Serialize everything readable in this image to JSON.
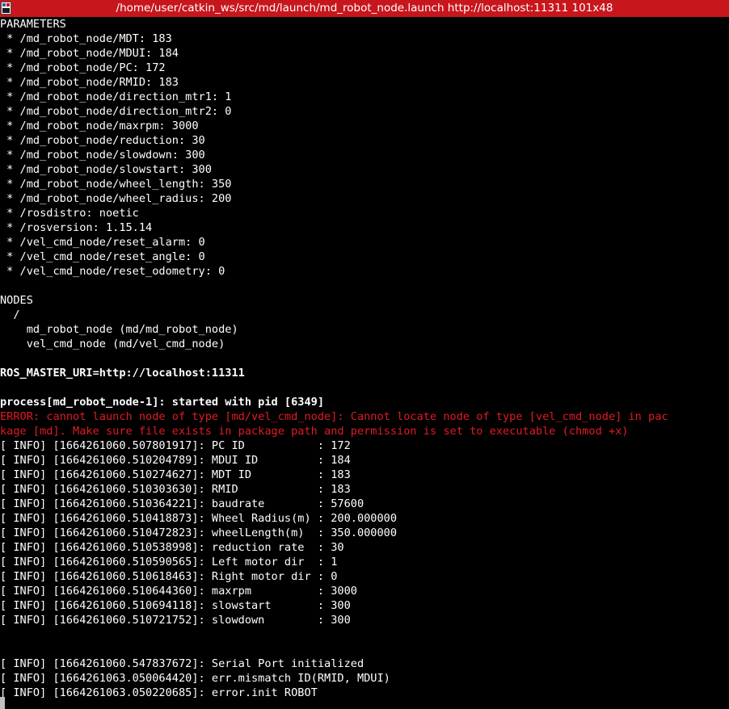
{
  "window": {
    "title": "/home/user/catkin_ws/src/md/launch/md_robot_node.launch http://localhost:11311 101x48",
    "title_bg": "#c8161d",
    "icon": "terminal-app-icon"
  },
  "colors": {
    "background": "#000000",
    "text": "#ffffff",
    "error": "#e01b24"
  },
  "terminal": {
    "lines": [
      {
        "text": "PARAMETERS",
        "style": "normal"
      },
      {
        "text": " * /md_robot_node/MDT: 183",
        "style": "normal"
      },
      {
        "text": " * /md_robot_node/MDUI: 184",
        "style": "normal"
      },
      {
        "text": " * /md_robot_node/PC: 172",
        "style": "normal"
      },
      {
        "text": " * /md_robot_node/RMID: 183",
        "style": "normal"
      },
      {
        "text": " * /md_robot_node/direction_mtr1: 1",
        "style": "normal"
      },
      {
        "text": " * /md_robot_node/direction_mtr2: 0",
        "style": "normal"
      },
      {
        "text": " * /md_robot_node/maxrpm: 3000",
        "style": "normal"
      },
      {
        "text": " * /md_robot_node/reduction: 30",
        "style": "normal"
      },
      {
        "text": " * /md_robot_node/slowdown: 300",
        "style": "normal"
      },
      {
        "text": " * /md_robot_node/slowstart: 300",
        "style": "normal"
      },
      {
        "text": " * /md_robot_node/wheel_length: 350",
        "style": "normal"
      },
      {
        "text": " * /md_robot_node/wheel_radius: 200",
        "style": "normal"
      },
      {
        "text": " * /rosdistro: noetic",
        "style": "normal"
      },
      {
        "text": " * /rosversion: 1.15.14",
        "style": "normal"
      },
      {
        "text": " * /vel_cmd_node/reset_alarm: 0",
        "style": "normal"
      },
      {
        "text": " * /vel_cmd_node/reset_angle: 0",
        "style": "normal"
      },
      {
        "text": " * /vel_cmd_node/reset_odometry: 0",
        "style": "normal"
      },
      {
        "text": "",
        "style": "normal"
      },
      {
        "text": "NODES",
        "style": "normal"
      },
      {
        "text": "  /",
        "style": "normal"
      },
      {
        "text": "    md_robot_node (md/md_robot_node)",
        "style": "normal"
      },
      {
        "text": "    vel_cmd_node (md/vel_cmd_node)",
        "style": "normal"
      },
      {
        "text": "",
        "style": "normal"
      },
      {
        "text": "ROS_MASTER_URI=http://localhost:11311",
        "style": "bold"
      },
      {
        "text": "",
        "style": "normal"
      },
      {
        "text": "process[md_robot_node-1]: started with pid [6349]",
        "style": "bold"
      },
      {
        "text": "ERROR: cannot launch node of type [md/vel_cmd_node]: Cannot locate node of type [vel_cmd_node] in pac",
        "style": "error"
      },
      {
        "text": "kage [md]. Make sure file exists in package path and permission is set to executable (chmod +x)",
        "style": "error"
      },
      {
        "text": "[ INFO] [1664261060.507801917]: PC ID           : 172",
        "style": "normal"
      },
      {
        "text": "[ INFO] [1664261060.510204789]: MDUI ID         : 184",
        "style": "normal"
      },
      {
        "text": "[ INFO] [1664261060.510274627]: MDT ID          : 183",
        "style": "normal"
      },
      {
        "text": "[ INFO] [1664261060.510303630]: RMID            : 183",
        "style": "normal"
      },
      {
        "text": "[ INFO] [1664261060.510364221]: baudrate        : 57600",
        "style": "normal"
      },
      {
        "text": "[ INFO] [1664261060.510418873]: Wheel Radius(m) : 200.000000",
        "style": "normal"
      },
      {
        "text": "[ INFO] [1664261060.510472823]: wheelLength(m)  : 350.000000",
        "style": "normal"
      },
      {
        "text": "[ INFO] [1664261060.510538998]: reduction rate  : 30",
        "style": "normal"
      },
      {
        "text": "[ INFO] [1664261060.510590565]: Left motor dir  : 1",
        "style": "normal"
      },
      {
        "text": "[ INFO] [1664261060.510618463]: Right motor dir : 0",
        "style": "normal"
      },
      {
        "text": "[ INFO] [1664261060.510644360]: maxrpm          : 3000",
        "style": "normal"
      },
      {
        "text": "[ INFO] [1664261060.510694118]: slowstart       : 300",
        "style": "normal"
      },
      {
        "text": "[ INFO] [1664261060.510721752]: slowdown        : 300",
        "style": "normal"
      },
      {
        "text": "",
        "style": "normal"
      },
      {
        "text": "",
        "style": "normal"
      },
      {
        "text": "[ INFO] [1664261060.547837672]: Serial Port initialized",
        "style": "normal"
      },
      {
        "text": "[ INFO] [1664261063.050064420]: err.mismatch ID(RMID, MDUI)",
        "style": "normal"
      },
      {
        "text": "[ INFO] [1664261063.050220685]: error.init ROBOT",
        "style": "normal"
      }
    ]
  }
}
